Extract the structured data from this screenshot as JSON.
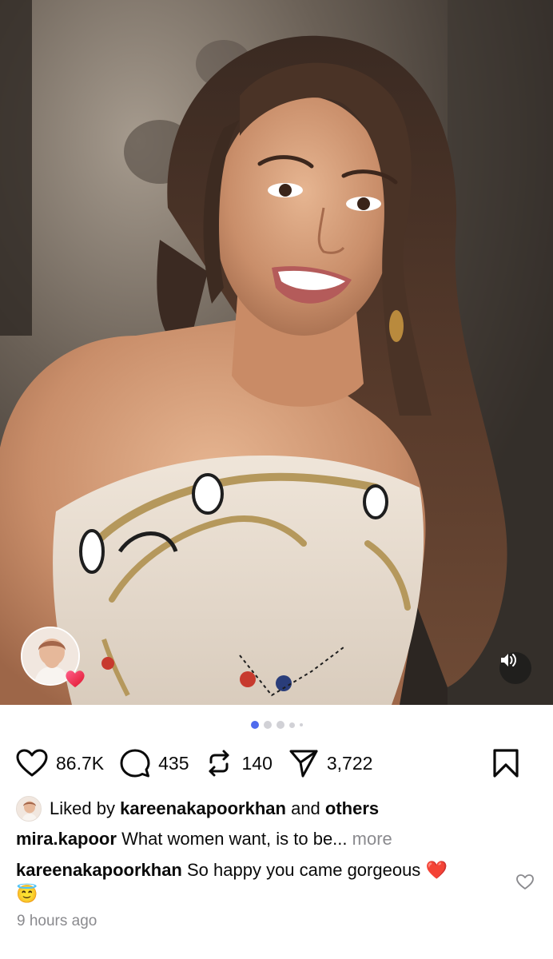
{
  "post": {
    "tagged_user_avatar_icon": "user-avatar",
    "mute_icon": "speaker-icon",
    "carousel": {
      "total": 5,
      "active_index": 0
    }
  },
  "actions": {
    "likes": "86.7K",
    "comments": "435",
    "reposts": "140",
    "shares": "3,722"
  },
  "liked_by": {
    "prefix": "Liked by",
    "user": "kareenakapoorkhan",
    "conjunction": "and",
    "others": "others"
  },
  "caption": {
    "username": "mira.kapoor",
    "text": "What women want, is to be...",
    "more": "more"
  },
  "comment": {
    "username": "kareenakapoorkhan",
    "text": "So happy you came gorgeous",
    "emoji_heart": "❤️",
    "emoji_angel": "😇"
  },
  "timestamp": "9 hours ago",
  "colors": {
    "accent_dot": "#4f6bed",
    "muted_text": "#8a8a8e",
    "heart_red": "#e0142c"
  }
}
